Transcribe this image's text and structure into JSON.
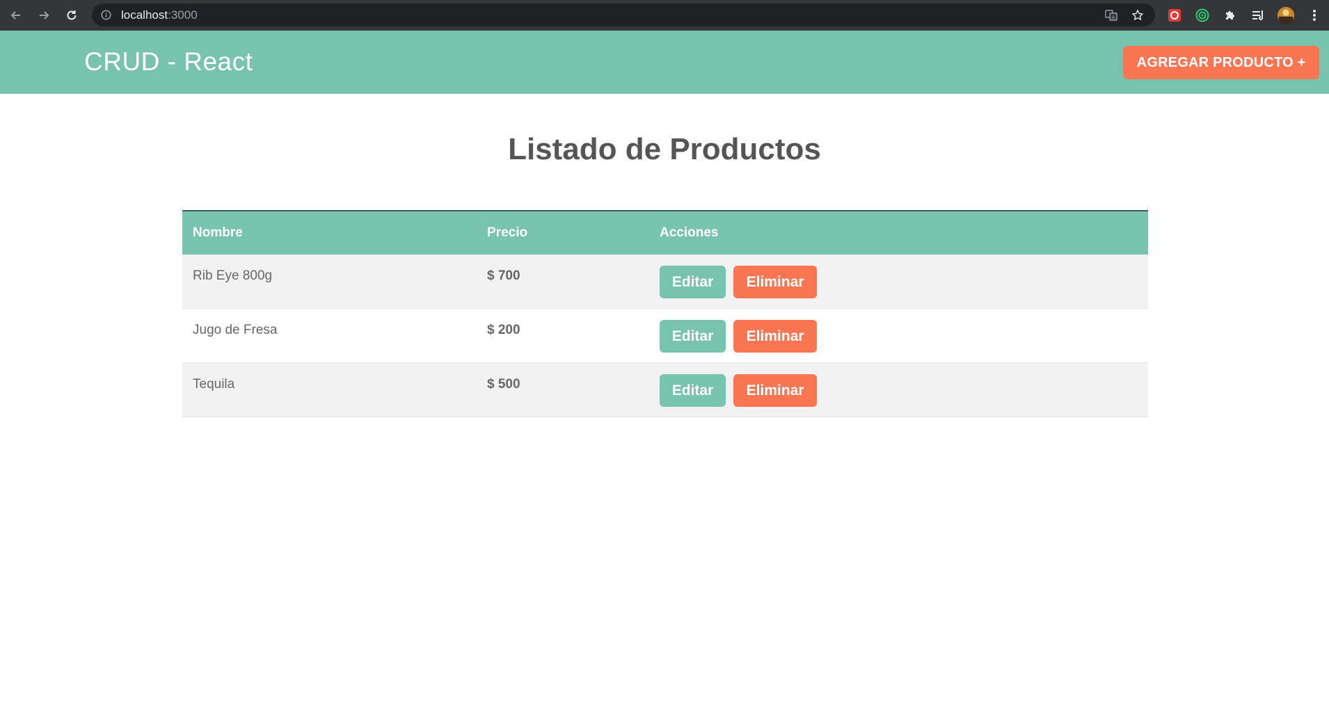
{
  "browser": {
    "url_host": "localhost",
    "url_port": ":3000"
  },
  "header": {
    "brand": "CRUD - React",
    "add_button": "AGREGAR PRODUCTO +"
  },
  "main": {
    "title": "Listado de Productos",
    "columns": [
      "Nombre",
      "Precio",
      "Acciones"
    ],
    "products": [
      {
        "name": "Rib Eye 800g",
        "price": "$ 700"
      },
      {
        "name": "Jugo de Fresa",
        "price": "$ 200"
      },
      {
        "name": "Tequila",
        "price": "$ 500"
      }
    ],
    "edit_label": "Editar",
    "delete_label": "Eliminar"
  },
  "colors": {
    "primary": "#78c3ad",
    "accent": "#fa7552",
    "chrome": "#35363a"
  }
}
